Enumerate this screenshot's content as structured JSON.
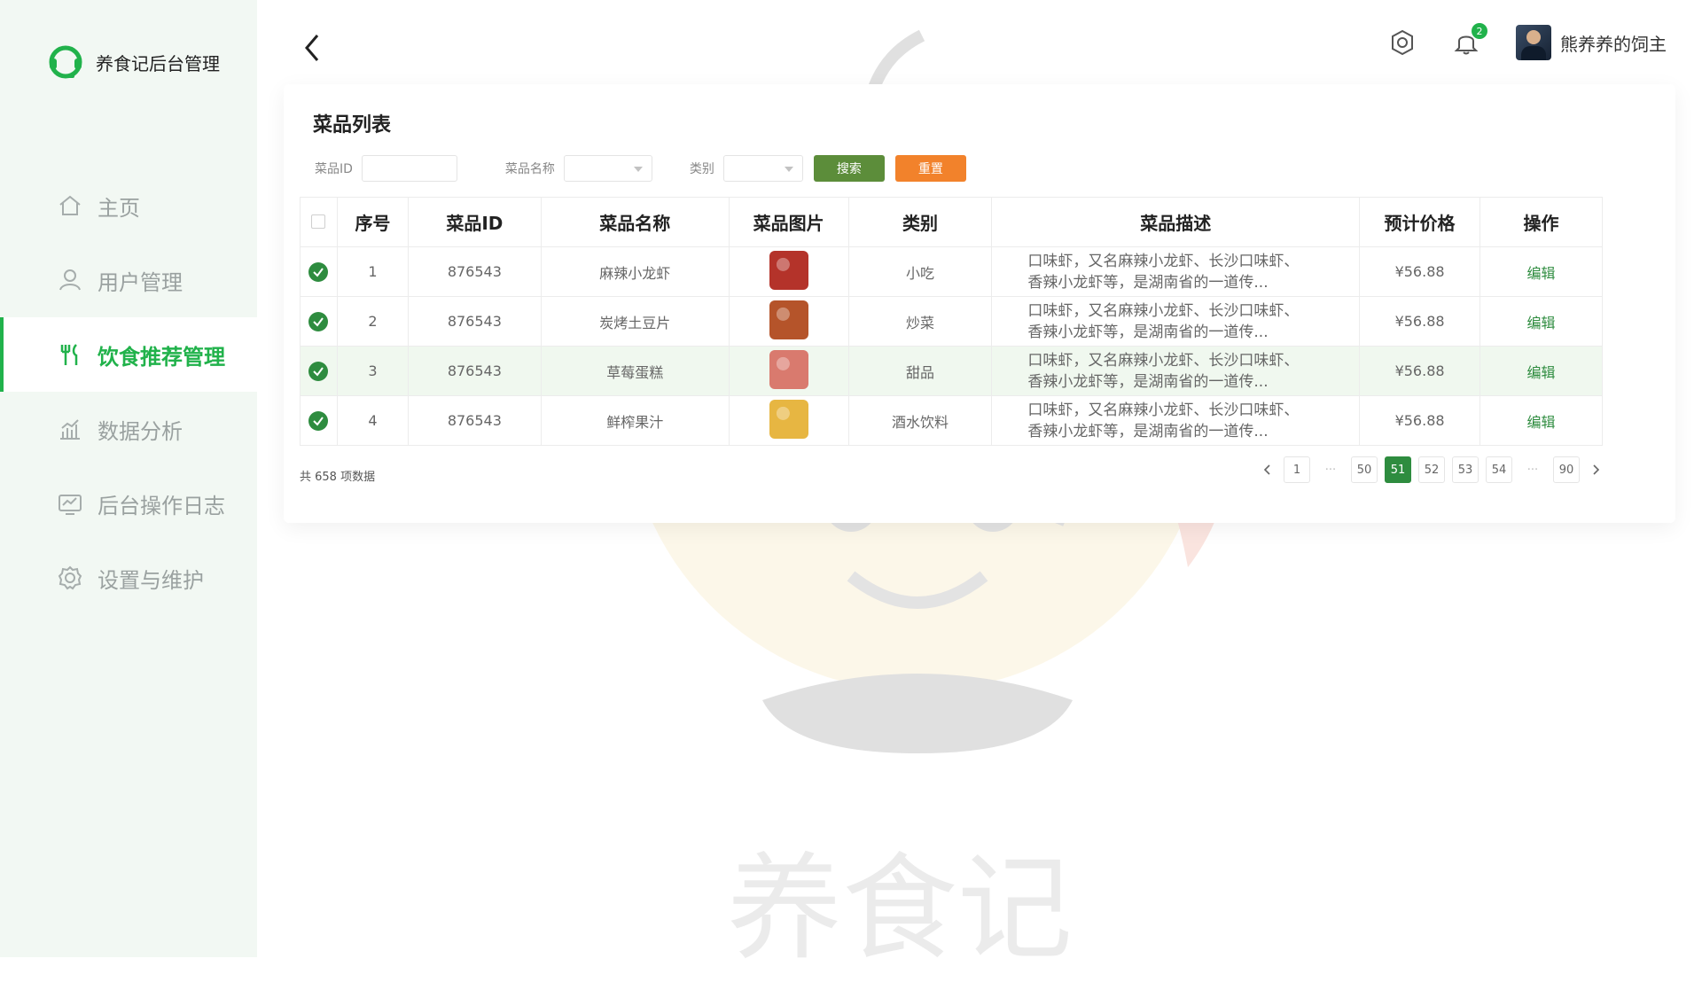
{
  "app": {
    "title": "养食记后台管理"
  },
  "sidebar": {
    "items": [
      {
        "label": "主页",
        "icon": "home-icon",
        "active": false
      },
      {
        "label": "用户管理",
        "icon": "user-icon",
        "active": false
      },
      {
        "label": "饮食推荐管理",
        "icon": "fork-knife-icon",
        "active": true
      },
      {
        "label": "数据分析",
        "icon": "bar-chart-icon",
        "active": false
      },
      {
        "label": "后台操作日志",
        "icon": "log-icon",
        "active": false
      },
      {
        "label": "设置与维护",
        "icon": "gear-icon",
        "active": false
      }
    ]
  },
  "header": {
    "notification_count": "2",
    "username": "熊养养的饲主"
  },
  "main": {
    "title": "菜品列表",
    "filters": {
      "id_label": "菜品ID",
      "name_label": "菜品名称",
      "category_label": "类别",
      "search_button": "搜索",
      "reset_button": "重置"
    },
    "table": {
      "headers": [
        "序号",
        "菜品ID",
        "菜品名称",
        "菜品图片",
        "类别",
        "菜品描述",
        "预计价格",
        "操作"
      ],
      "rows": [
        {
          "index": "1",
          "id": "876543",
          "name": "麻辣小龙虾",
          "category": "小吃",
          "desc_line1": "口味虾，又名麻辣小龙虾、长沙口味虾、",
          "desc_line2": "香辣小龙虾等，是湖南省的一道传...",
          "price": "¥56.88",
          "action": "编辑",
          "img_color": "#b4332a"
        },
        {
          "index": "2",
          "id": "876543",
          "name": "炭烤土豆片",
          "category": "炒菜",
          "desc_line1": "口味虾，又名麻辣小龙虾、长沙口味虾、",
          "desc_line2": "香辣小龙虾等，是湖南省的一道传...",
          "price": "¥56.88",
          "action": "编辑",
          "img_color": "#b5542a"
        },
        {
          "index": "3",
          "id": "876543",
          "name": "草莓蛋糕",
          "category": "甜品",
          "desc_line1": "口味虾，又名麻辣小龙虾、长沙口味虾、",
          "desc_line2": "香辣小龙虾等，是湖南省的一道传...",
          "price": "¥56.88",
          "action": "编辑",
          "img_color": "#d97a6e"
        },
        {
          "index": "4",
          "id": "876543",
          "name": "鲜榨果汁",
          "category": "酒水饮料",
          "desc_line1": "口味虾，又名麻辣小龙虾、长沙口味虾、",
          "desc_line2": "香辣小龙虾等，是湖南省的一道传...",
          "price": "¥56.88",
          "action": "编辑",
          "img_color": "#e7b642"
        }
      ]
    },
    "footer": {
      "total": "共 658 项数据",
      "pages": [
        "1",
        "50",
        "51",
        "52",
        "53",
        "54",
        "90"
      ],
      "current_page": "51"
    }
  },
  "watermark_text": "养食记"
}
